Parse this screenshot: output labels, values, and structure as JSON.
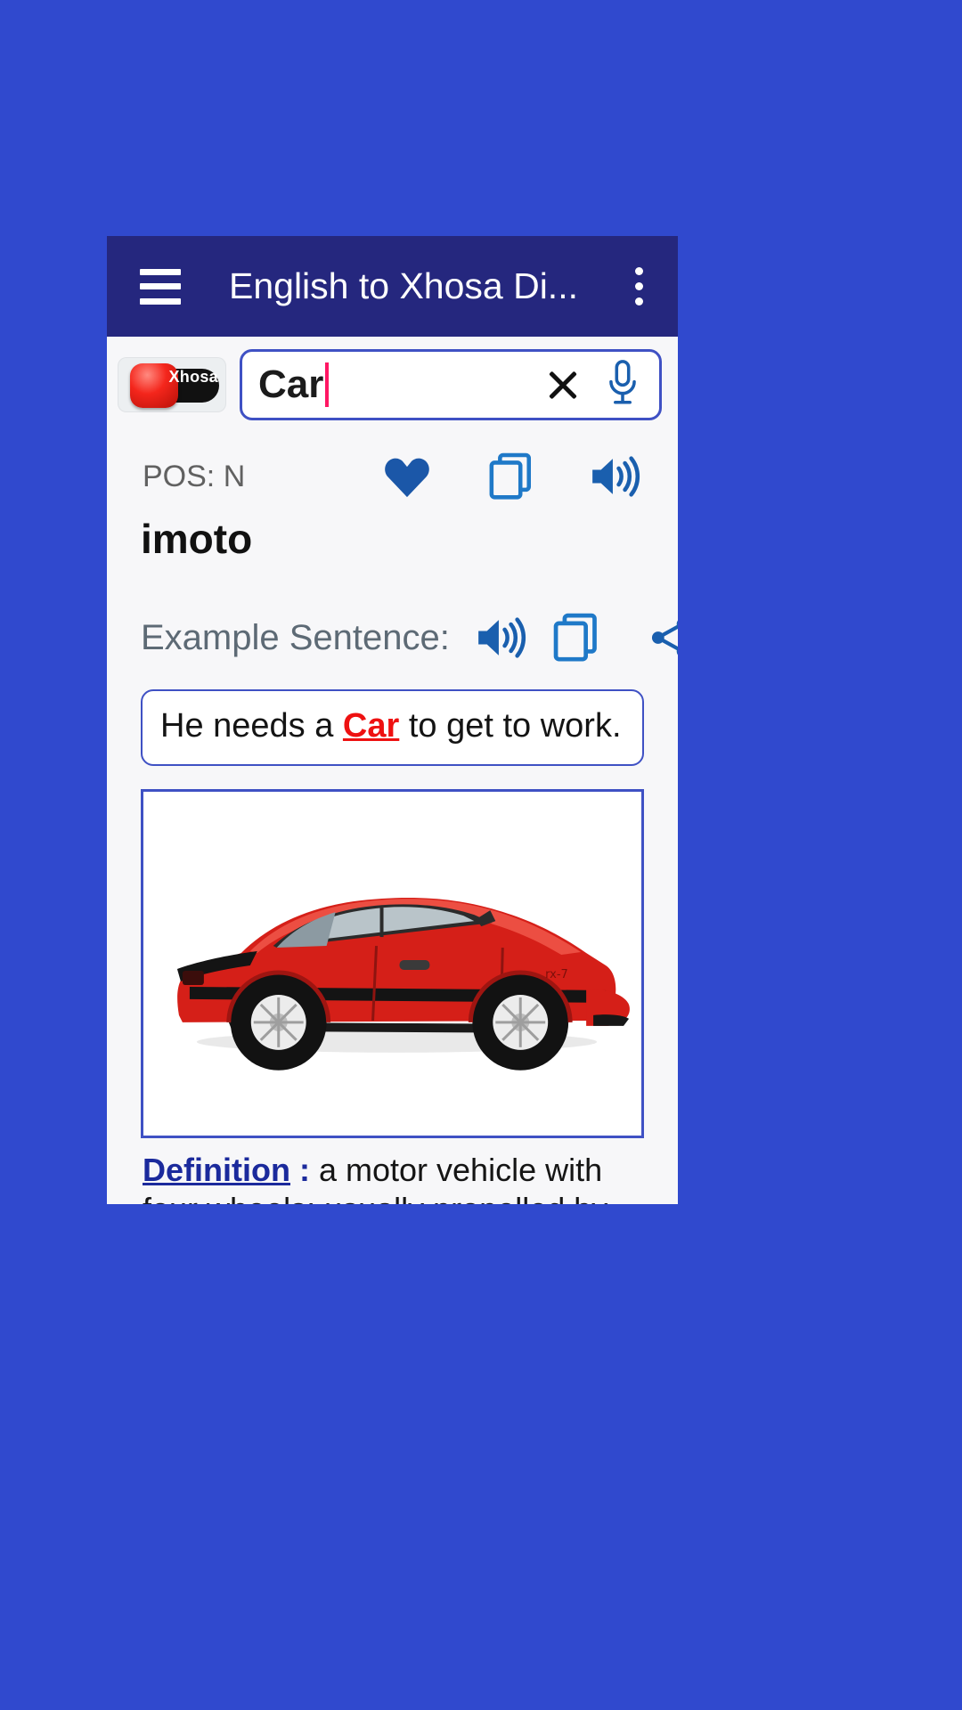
{
  "app": {
    "title": "English to Xhosa Di...",
    "menu_icon": "hamburger-menu-icon",
    "overflow_icon": "more-vertical-icon",
    "bar_color": "#25277e",
    "background_color": "#3049ce"
  },
  "search": {
    "value": "Car",
    "placeholder": "",
    "clear_label": "×",
    "mic_icon": "microphone-icon",
    "clear_icon": "close-icon",
    "language_chip": {
      "label": "Xhosa",
      "icon": "xhosa-flag-badge"
    }
  },
  "result": {
    "pos_label": "POS: N",
    "translation": "imoto",
    "icons": {
      "favorite": "heart-filled-icon",
      "copy": "copy-icon",
      "speak": "speaker-icon"
    }
  },
  "example": {
    "label": "Example Sentence:",
    "icons": {
      "speak": "speaker-icon",
      "copy": "copy-icon",
      "share": "share-icon"
    },
    "sentence_before": "He needs a ",
    "sentence_highlight": "Car",
    "sentence_after": " to get to work."
  },
  "image": {
    "alt": "red sports car side view",
    "name": "car-illustration"
  },
  "definition": {
    "label": "Definition",
    "separator": " :",
    "text": " a motor vehicle with four wheels; usually propelled by an internal combustion engine"
  },
  "colors": {
    "accent_blue": "#3f51c4",
    "icon_blue": "#1f66b0",
    "heart_blue": "#1b57a8",
    "highlight_red": "#ee1111",
    "caret_pink": "#ff1763",
    "appbar": "#25277e",
    "page_bg": "#3049ce"
  }
}
